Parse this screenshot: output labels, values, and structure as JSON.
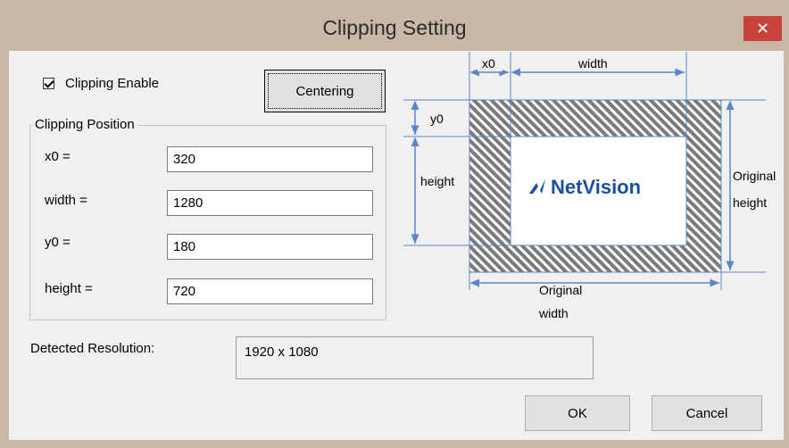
{
  "window": {
    "title": "Clipping Setting",
    "close_glyph": "✕"
  },
  "clipping": {
    "enable_label": "Clipping Enable",
    "enabled": true,
    "centering_label": "Centering"
  },
  "position": {
    "group_label": "Clipping Position",
    "fields": [
      {
        "label": "x0 =",
        "value": "320"
      },
      {
        "label": "width =",
        "value": "1280"
      },
      {
        "label": "y0 =",
        "value": "180"
      },
      {
        "label": "height =",
        "value": "720"
      }
    ]
  },
  "resolution": {
    "label": "Detected Resolution:",
    "value": "1920 x 1080"
  },
  "buttons": {
    "ok": "OK",
    "cancel": "Cancel"
  },
  "diagram": {
    "x0": "x0",
    "width": "width",
    "y0": "y0",
    "height": "height",
    "original_height_1": "Original",
    "original_height_2": "height",
    "original_width_1": "Original",
    "original_width_2": "width",
    "logo": "NetVision",
    "colors": {
      "guide": "#5b86c5",
      "hatch": "#7a7a7a",
      "logo": "#1a4fa3"
    }
  }
}
